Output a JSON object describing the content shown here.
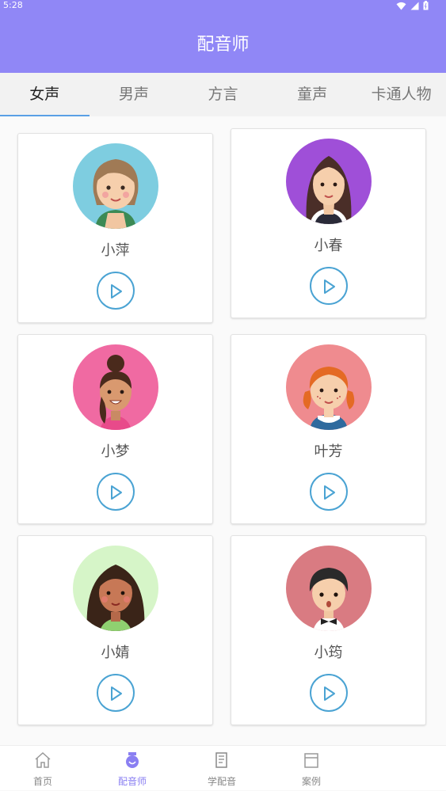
{
  "status": {
    "time": "5:28"
  },
  "header": {
    "title": "配音师"
  },
  "tabs": [
    {
      "label": "女声",
      "active": true
    },
    {
      "label": "男声"
    },
    {
      "label": "方言"
    },
    {
      "label": "童声"
    },
    {
      "label": "卡通人物"
    }
  ],
  "voices": [
    {
      "name": "小萍",
      "avatar_bg": "#7ecde0",
      "avatar": "woman-brown-hair-avatar"
    },
    {
      "name": "小春",
      "avatar_bg": "#9f4fd8",
      "avatar": "woman-long-black-hair-avatar"
    },
    {
      "name": "小梦",
      "avatar_bg": "#f06aa2",
      "avatar": "woman-bun-hair-avatar"
    },
    {
      "name": "叶芳",
      "avatar_bg": "#ef8b8f",
      "avatar": "girl-red-braids-avatar"
    },
    {
      "name": "小婧",
      "avatar_bg": "#d6f5c8",
      "avatar": "woman-curly-hair-avatar"
    },
    {
      "name": "小筠",
      "avatar_bg": "#d97b82",
      "avatar": "boy-bowtie-avatar"
    }
  ],
  "bottom_nav": [
    {
      "label": "首页",
      "icon": "home-icon"
    },
    {
      "label": "配音师",
      "icon": "voice-actor-icon",
      "active": true
    },
    {
      "label": "学配音",
      "icon": "book-icon"
    },
    {
      "label": "案例",
      "icon": "case-icon"
    }
  ],
  "colors": {
    "accent": "#9087f6",
    "play": "#4aa3d3",
    "tab_indicator": "#5aa0e6"
  }
}
